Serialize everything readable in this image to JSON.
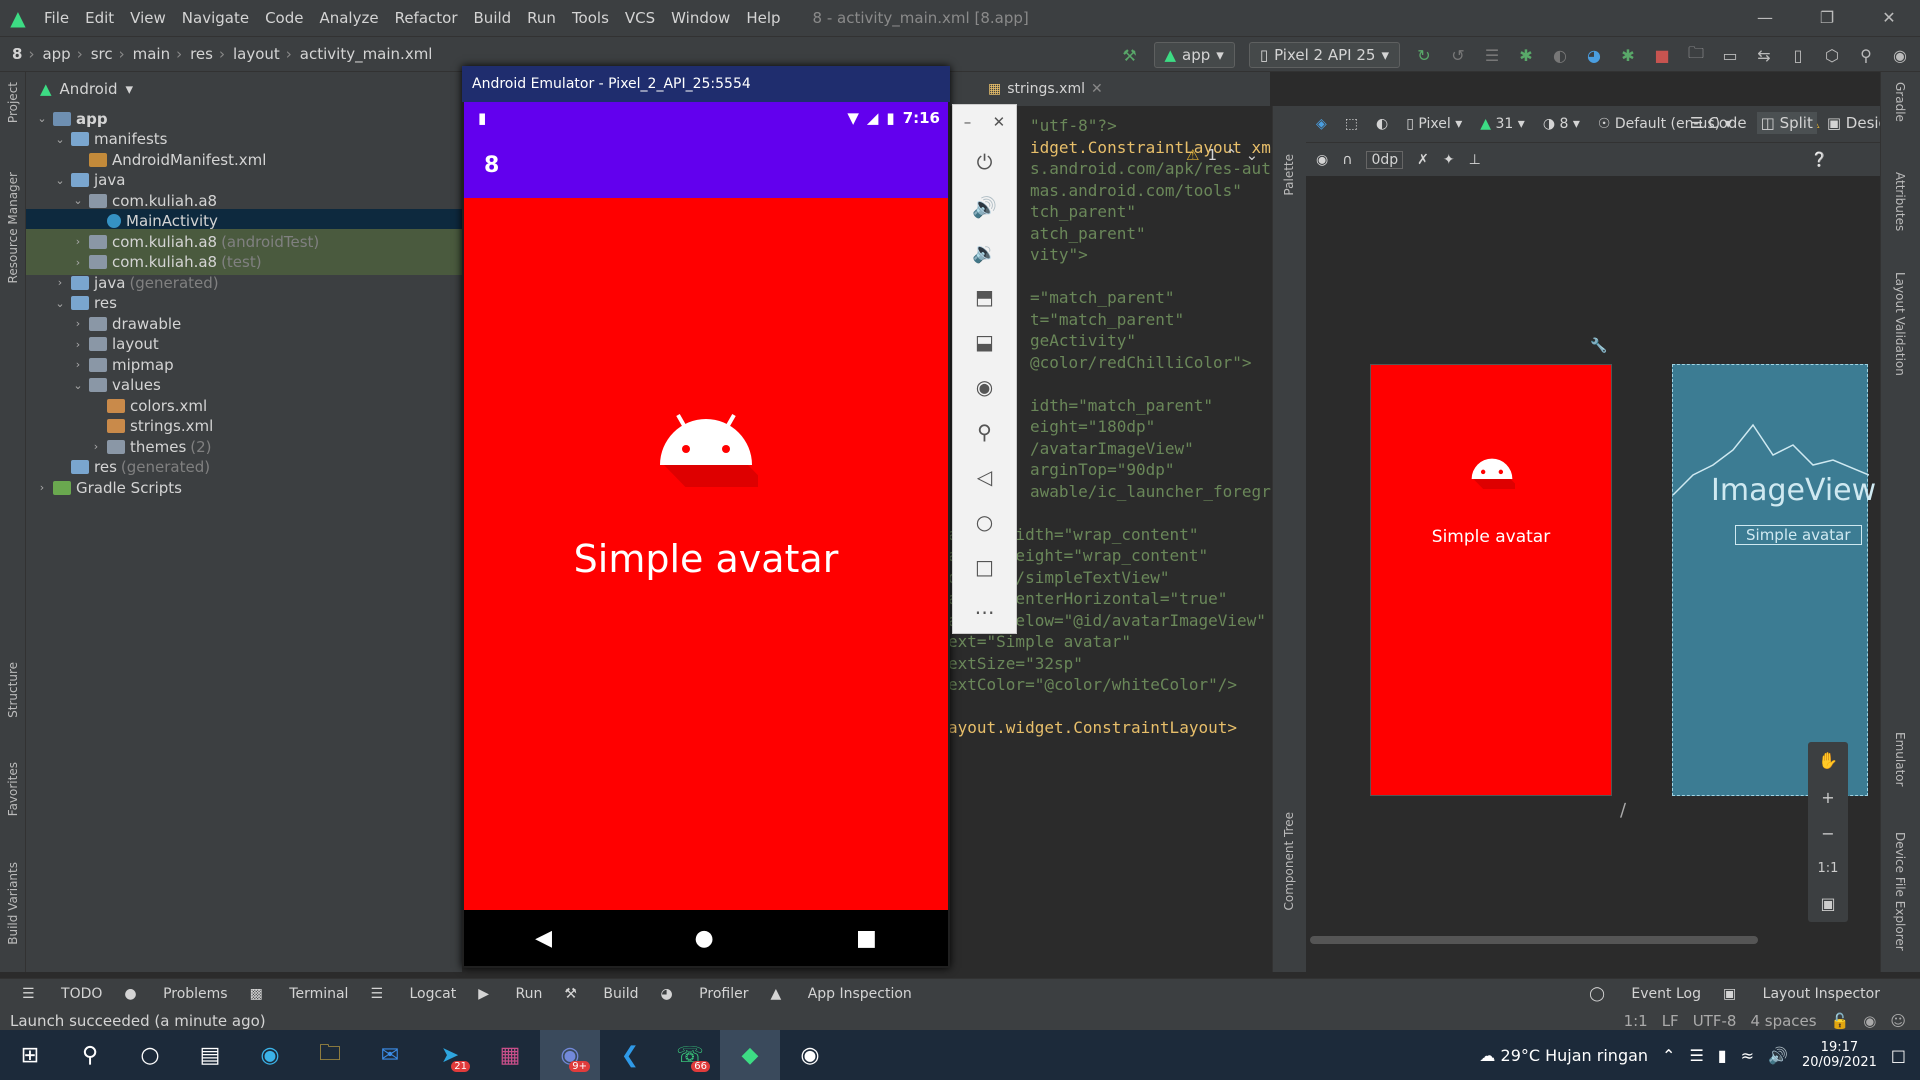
{
  "window": {
    "menu": [
      "File",
      "Edit",
      "View",
      "Navigate",
      "Code",
      "Analyze",
      "Refactor",
      "Build",
      "Run",
      "Tools",
      "VCS",
      "Window",
      "Help"
    ],
    "title": "8 - activity_main.xml [8.app]"
  },
  "breadcrumb": [
    "8",
    "app",
    "src",
    "main",
    "res",
    "layout",
    "activity_main.xml"
  ],
  "toolbar": {
    "run_config": "app",
    "device": "Pixel 2 API 25"
  },
  "project": {
    "view_label": "Android",
    "tree": [
      {
        "label": "app",
        "indent": 0,
        "arrow": "v",
        "kind": "app"
      },
      {
        "label": "manifests",
        "indent": 1,
        "arrow": "v",
        "kind": "folder"
      },
      {
        "label": "AndroidManifest.xml",
        "indent": 2,
        "arrow": "",
        "kind": "file"
      },
      {
        "label": "java",
        "indent": 1,
        "arrow": "v",
        "kind": "folder"
      },
      {
        "label": "com.kuliah.a8",
        "indent": 2,
        "arrow": "v",
        "kind": "pkg"
      },
      {
        "label": "MainActivity",
        "indent": 3,
        "arrow": "",
        "kind": "class",
        "selected": true
      },
      {
        "label": "com.kuliah.a8",
        "suffix": "(androidTest)",
        "indent": 2,
        "arrow": ">",
        "kind": "pkg",
        "highlight": true
      },
      {
        "label": "com.kuliah.a8",
        "suffix": "(test)",
        "indent": 2,
        "arrow": ">",
        "kind": "pkg",
        "highlight": true
      },
      {
        "label": "java",
        "suffix": "(generated)",
        "indent": 1,
        "arrow": ">",
        "kind": "folder"
      },
      {
        "label": "res",
        "indent": 1,
        "arrow": "v",
        "kind": "folder"
      },
      {
        "label": "drawable",
        "indent": 2,
        "arrow": ">",
        "kind": "pkg"
      },
      {
        "label": "layout",
        "indent": 2,
        "arrow": ">",
        "kind": "pkg"
      },
      {
        "label": "mipmap",
        "indent": 2,
        "arrow": ">",
        "kind": "pkg"
      },
      {
        "label": "values",
        "indent": 2,
        "arrow": "v",
        "kind": "pkg"
      },
      {
        "label": "colors.xml",
        "indent": 3,
        "arrow": "",
        "kind": "xml"
      },
      {
        "label": "strings.xml",
        "indent": 3,
        "arrow": "",
        "kind": "xml"
      },
      {
        "label": "themes",
        "suffix": "(2)",
        "indent": 3,
        "arrow": ">",
        "kind": "pkg"
      },
      {
        "label": "res",
        "suffix": "(generated)",
        "indent": 1,
        "arrow": "",
        "kind": "folder"
      },
      {
        "label": "Gradle Scripts",
        "indent": 0,
        "arrow": ">",
        "kind": "gradle"
      }
    ]
  },
  "left_strip": [
    "Project",
    "Resource Manager",
    "Structure",
    "Favorites",
    "Build Variants"
  ],
  "emulator": {
    "title": "Android Emulator - Pixel_2_API_25:5554",
    "time": "7:16",
    "app_bar_title": "8",
    "text": "Simple avatar",
    "side_tools": [
      "power",
      "volume-up",
      "volume-down",
      "rotate-left",
      "rotate-right",
      "camera",
      "zoom",
      "back",
      "home",
      "overview",
      "more"
    ]
  },
  "editor": {
    "tab": "strings.xml",
    "warning_count": "1",
    "lines": [
      {
        "t": "\"utf-8\"?>",
        "c": "s"
      },
      {
        "t": "idget.ConstraintLayout xml",
        "c": "k"
      },
      {
        "t": "s.android.com/apk/res-auto",
        "c": "s"
      },
      {
        "t": "mas.android.com/tools\"",
        "c": "s"
      },
      {
        "t": "tch_parent\"",
        "c": "s"
      },
      {
        "t": "atch_parent\"",
        "c": "s"
      },
      {
        "t": "vity\">",
        "c": "s"
      },
      {
        "t": "",
        "c": "s"
      },
      {
        "t": "=\"match_parent\"",
        "c": "s"
      },
      {
        "t": "t=\"match_parent\"",
        "c": "s"
      },
      {
        "t": "geActivity\"",
        "c": "s"
      },
      {
        "t": "@color/redChilliColor\">",
        "c": "s"
      },
      {
        "t": "",
        "c": "s"
      },
      {
        "t": "idth=\"match_parent\"",
        "c": "s"
      },
      {
        "t": "eight=\"180dp\"",
        "c": "s"
      },
      {
        "t": "/avatarImageView\"",
        "c": "s"
      },
      {
        "t": "arginTop=\"90dp\"",
        "c": "s"
      },
      {
        "t": "awable/ic_launcher_foregro",
        "c": "s"
      },
      {
        "t": "",
        "c": "s"
      },
      {
        "t": "ayout_width=\"wrap_content\"",
        "c": "s"
      },
      {
        "t": "ayout_height=\"wrap_content\"",
        "c": "s"
      },
      {
        "t": "d=\"@+id/simpleTextView\"",
        "c": "s"
      },
      {
        "t": "ayout_centerHorizontal=\"true\"",
        "c": "s"
      },
      {
        "t": "ayout_below=\"@id/avatarImageView\"",
        "c": "s"
      },
      {
        "t": "ext=\"Simple avatar\"",
        "c": "s"
      },
      {
        "t": "extSize=\"32sp\"",
        "c": "s"
      },
      {
        "t": "extColor=\"@color/whiteColor\"/>",
        "c": "s"
      },
      {
        "t": "",
        "c": "s"
      },
      {
        "t": "ayout.widget.ConstraintLayout>",
        "c": "k"
      }
    ]
  },
  "design": {
    "view_modes": [
      "Code",
      "Split",
      "Design"
    ],
    "device": "Pixel",
    "api": "31",
    "night": "8",
    "locale": "Default (en-us)",
    "margin": "0dp",
    "preview_text": "Simple avatar",
    "blueprint_image_label": "ImageView",
    "blueprint_text_label": "Simple avatar",
    "zoom_ratio": "1:1"
  },
  "right_strip": [
    "Gradle",
    "Attributes",
    "Layout Validation",
    "Emulator",
    "Device File Explorer"
  ],
  "palette_labels": [
    "Palette",
    "Component Tree"
  ],
  "bottom_tools": [
    "TODO",
    "Problems",
    "Terminal",
    "Logcat",
    "Run",
    "Build",
    "Profiler",
    "App Inspection"
  ],
  "bottom_right": [
    "Event Log",
    "Layout Inspector"
  ],
  "status": {
    "message": "Launch succeeded (a minute ago)",
    "pos": "1:1",
    "eol": "LF",
    "enc": "UTF-8",
    "indent": "4 spaces"
  },
  "taskbar": {
    "weather": "29°C  Hujan ringan",
    "time": "19:17",
    "date": "20/09/2021",
    "badges": {
      "telegram": "21",
      "discord": "9+",
      "whatsapp": "66"
    }
  }
}
